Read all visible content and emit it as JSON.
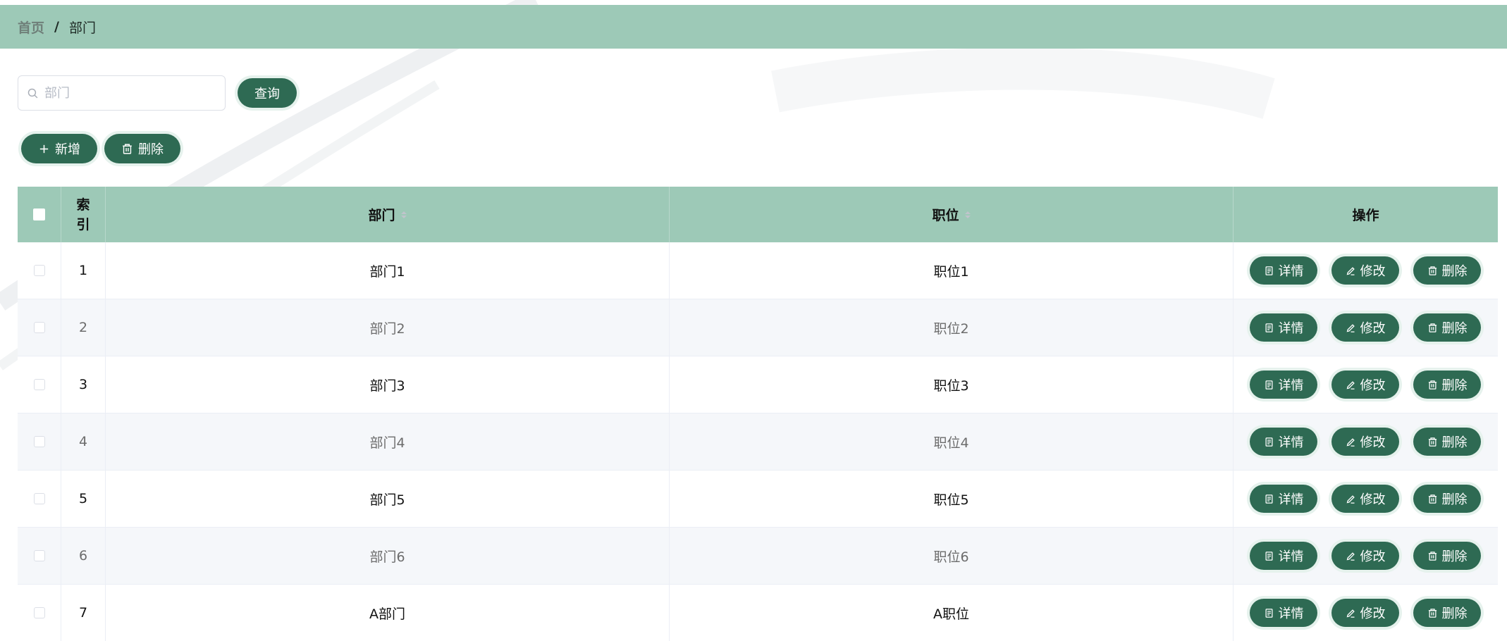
{
  "breadcrumb": {
    "home": "首页",
    "separator": "/",
    "current": "部门"
  },
  "search": {
    "placeholder": "部门",
    "value": ""
  },
  "buttons": {
    "query": "查询",
    "add": "新增",
    "delete": "删除"
  },
  "table": {
    "headers": {
      "index": "索\n引",
      "dept": "部门",
      "pos": "职位",
      "ops": "操作"
    },
    "op_labels": {
      "detail": "详情",
      "edit": "修改",
      "delete": "删除"
    },
    "rows": [
      {
        "index": "1",
        "dept": "部门1",
        "pos": "职位1"
      },
      {
        "index": "2",
        "dept": "部门2",
        "pos": "职位2"
      },
      {
        "index": "3",
        "dept": "部门3",
        "pos": "职位3"
      },
      {
        "index": "4",
        "dept": "部门4",
        "pos": "职位4"
      },
      {
        "index": "5",
        "dept": "部门5",
        "pos": "职位5"
      },
      {
        "index": "6",
        "dept": "部门6",
        "pos": "职位6"
      },
      {
        "index": "7",
        "dept": "A部门",
        "pos": "A职位"
      }
    ]
  },
  "colors": {
    "header_bg": "#9dc9b7",
    "button": "#2e6a53",
    "stripe": "#f5f7fa"
  },
  "icons": {
    "search": "search-icon",
    "plus": "plus-icon",
    "trash": "trash-icon",
    "document": "document-icon",
    "pen": "pen-icon"
  }
}
